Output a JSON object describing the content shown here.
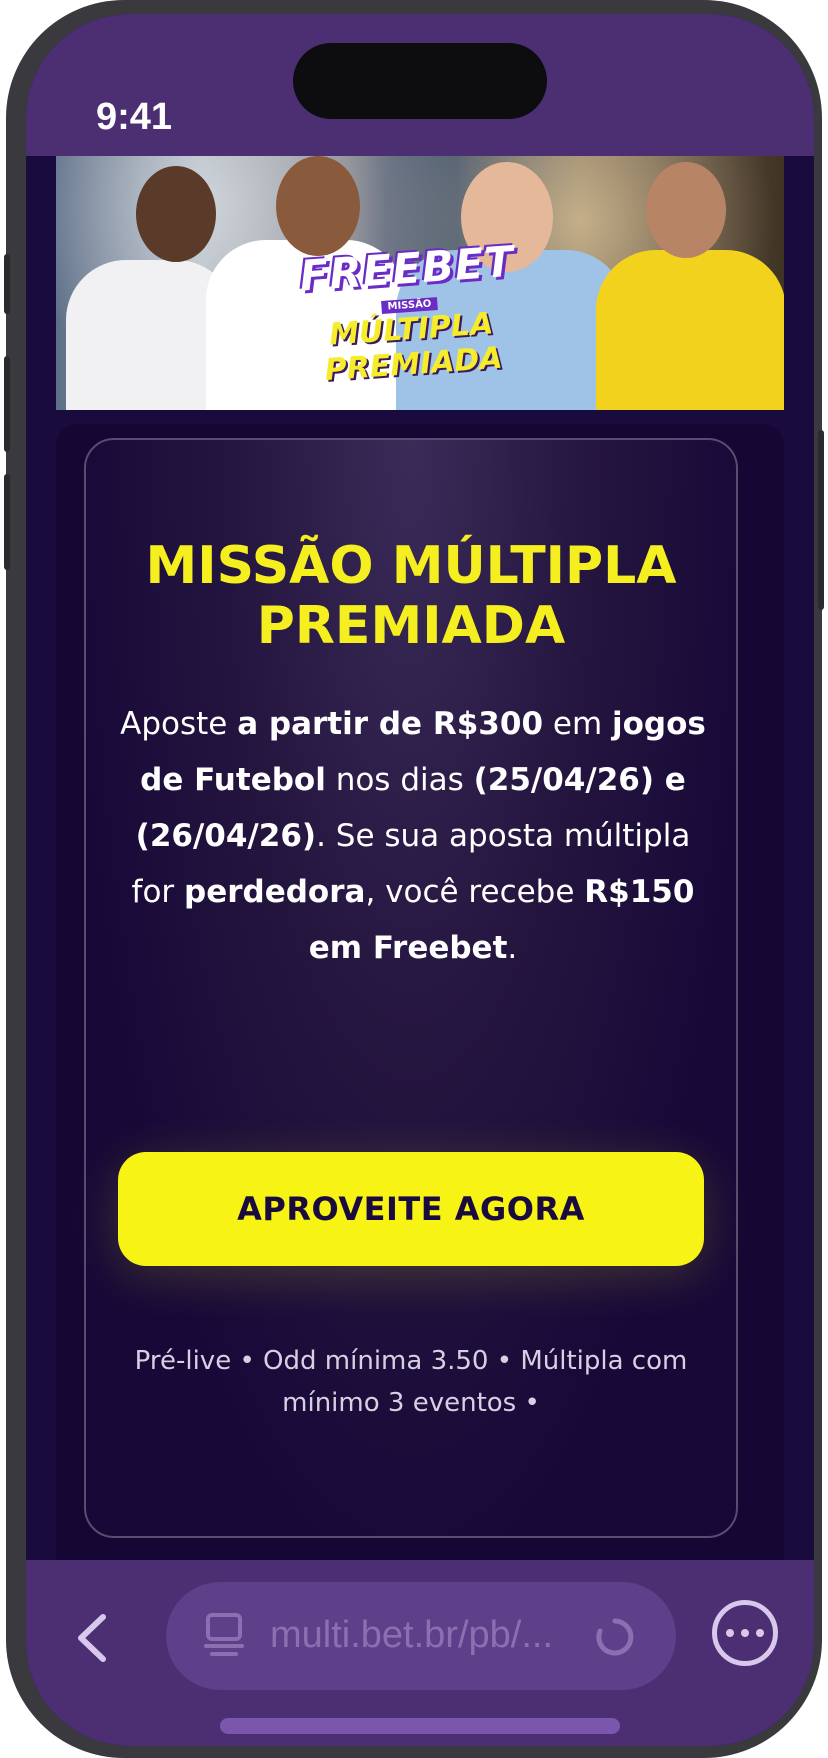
{
  "status": {
    "time": "9:41"
  },
  "banner": {
    "title_line1": "FREEBET",
    "title_tag": "MISSÃO",
    "title_line2": "MÚLTIPLA PREMIADA"
  },
  "card": {
    "title": "MISSÃO MÚLTIPLA PREMIADA",
    "description": {
      "p1": "Aposte ",
      "b1": "a partir de R$300",
      "p2": " em ",
      "b2": "jogos de Futebol",
      "p3": " nos dias ",
      "b3": "(25/04/26) e (26/04/26)",
      "p4": ". Se sua aposta múltipla for ",
      "b4": "perdedora",
      "p5": ", você recebe ",
      "b5": "R$150 em Freebet",
      "p6": "."
    },
    "cta_label": "APROVEITE AGORA",
    "fineprint": "Pré-live • Odd mínima 3.50 • Múltipla com mínimo 3 eventos •"
  },
  "browser": {
    "url": "multi.bet.br/pb/...",
    "icons": [
      "back-chevron-icon",
      "site-settings-icon",
      "reload-icon",
      "more-icon"
    ]
  },
  "colors": {
    "purple_bar": "#4b2f72",
    "page_bg": "#1a0b3f",
    "title_yellow": "#f5ef1f",
    "cta_yellow": "#f6f315"
  }
}
